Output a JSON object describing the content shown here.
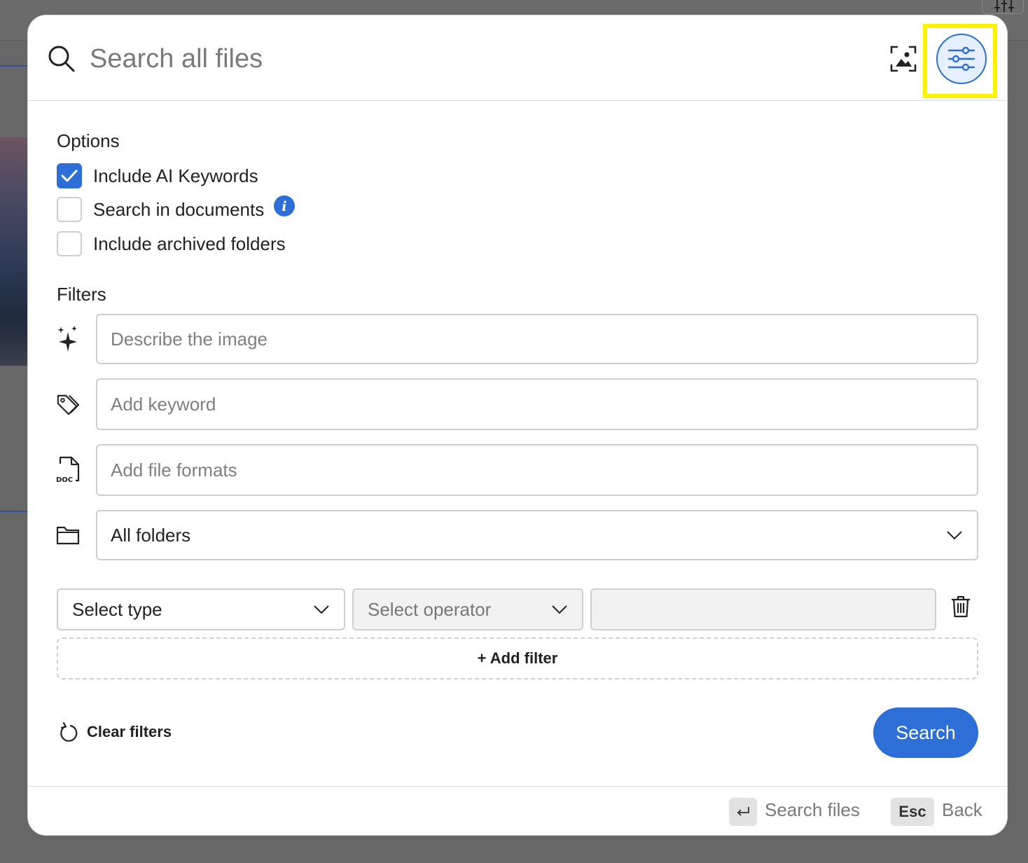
{
  "header": {
    "search_placeholder": "Search all files",
    "image_search_icon": "image-search-icon",
    "filters_icon": "sliders-icon"
  },
  "options": {
    "title": "Options",
    "items": [
      {
        "label": "Include AI Keywords",
        "checked": true
      },
      {
        "label": "Search in documents",
        "checked": false,
        "info": true
      },
      {
        "label": "Include archived folders",
        "checked": false
      }
    ]
  },
  "filters": {
    "title": "Filters",
    "describe_placeholder": "Describe the image",
    "keyword_placeholder": "Add keyword",
    "formats_placeholder": "Add file formats",
    "formats_icon_text": "DOC",
    "folder_value": "All folders",
    "condition": {
      "type_label": "Select type",
      "operator_label": "Select operator"
    },
    "add_filter_label": "+ Add filter"
  },
  "actions": {
    "clear_label": "Clear filters",
    "search_label": "Search"
  },
  "footer": {
    "search_files_label": "Search files",
    "esc_key": "Esc",
    "back_label": "Back"
  },
  "colors": {
    "accent": "#2d6fd6",
    "highlight": "#fff200",
    "overlay": "#676767"
  }
}
